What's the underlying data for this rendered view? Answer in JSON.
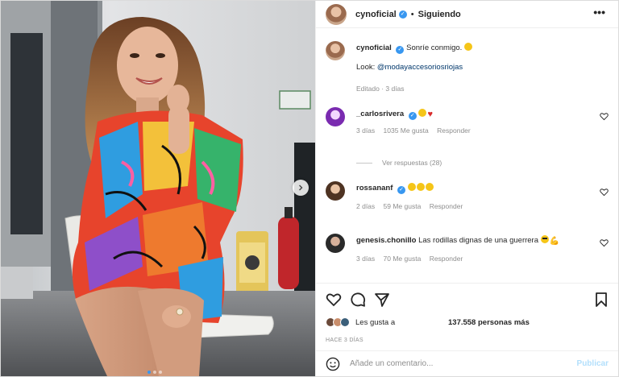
{
  "header": {
    "username": "cynoficial",
    "separator": "•",
    "follow_state": "Siguiendo",
    "more_icon": "more-options-icon"
  },
  "caption": {
    "username": "cynoficial",
    "text": "Sonríe conmigo.",
    "look_prefix": "Look:",
    "look_link": "@modayaccesoriosriojas",
    "meta": "Editado · 3 días"
  },
  "comments": [
    {
      "username": "_carlosrivera",
      "verified": true,
      "text": "",
      "time": "3 días",
      "likes": "1035 Me gusta",
      "reply": "Responder"
    },
    {
      "username": "rossananf",
      "verified": true,
      "text": "",
      "time": "2 días",
      "likes": "59 Me gusta",
      "reply": "Responder"
    },
    {
      "username": "genesis.chonillo",
      "verified": false,
      "text": "Las rodillas dignas de una guerrera",
      "time": "3 días",
      "likes": "70 Me gusta",
      "reply": "Responder"
    }
  ],
  "view_replies": "Ver respuestas (28)",
  "likes": {
    "prefix": "Les gusta a",
    "count": "137.558 personas más"
  },
  "posted_ago": "HACE 3 DÍAS",
  "composer": {
    "placeholder": "Añade un comentario...",
    "post_label": "Publicar"
  },
  "colors": {
    "verified": "#3897f0",
    "link": "#00376b",
    "muted": "#8e8e8e",
    "post_disabled": "#b2dffc"
  }
}
